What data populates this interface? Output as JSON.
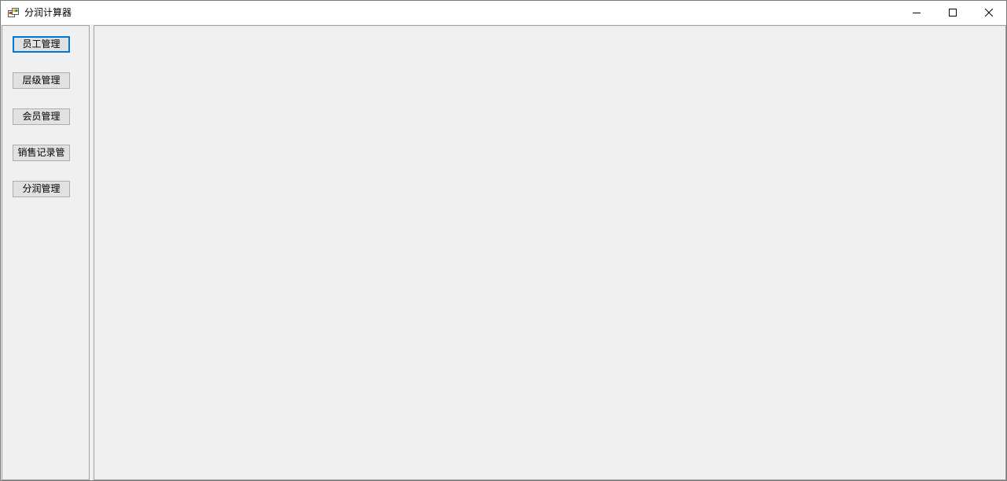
{
  "window": {
    "title": "分润计算器",
    "app_icon": "app-window-icon",
    "controls": [
      "minimize-icon",
      "maximize-icon",
      "close-icon"
    ]
  },
  "sidebar": {
    "items": [
      {
        "label": "员工管理",
        "focused": true
      },
      {
        "label": "层级管理",
        "focused": false
      },
      {
        "label": "会员管理",
        "focused": false
      },
      {
        "label": "销售记录管",
        "focused": false
      },
      {
        "label": "分润管理",
        "focused": false
      }
    ]
  },
  "colors": {
    "focus_border": "#0078d7",
    "background": "#f0f0f0",
    "button_face": "#e1e1e1"
  }
}
